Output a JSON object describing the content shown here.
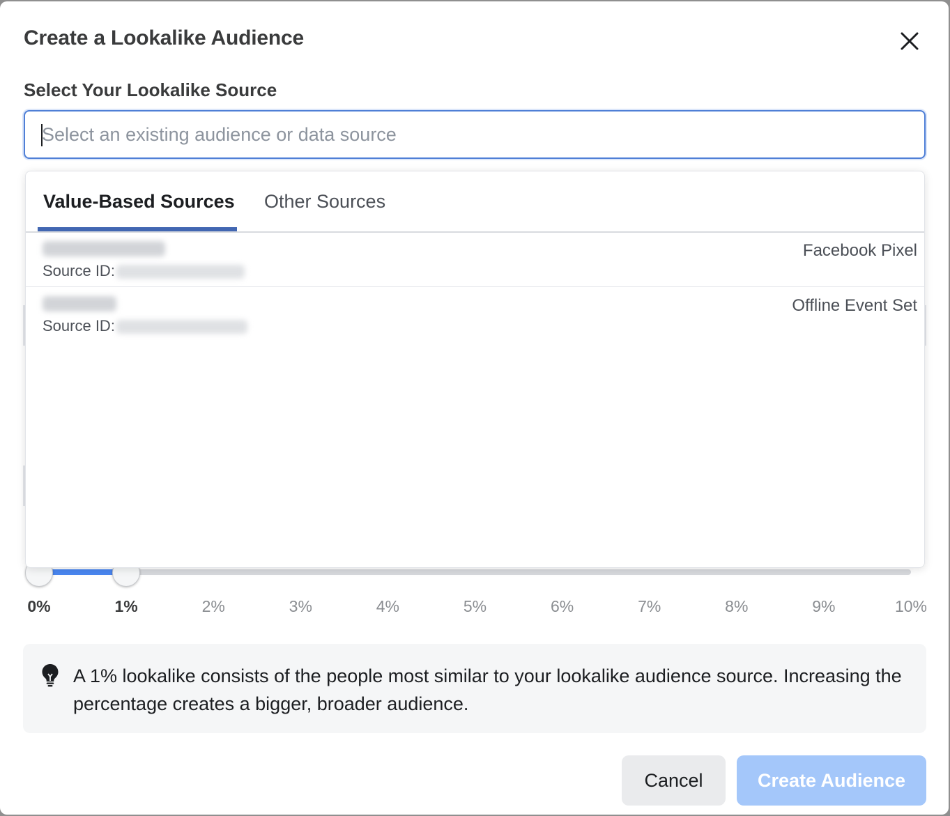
{
  "dialog": {
    "title": "Create a Lookalike Audience",
    "close_icon": "close-x-icon"
  },
  "source": {
    "label": "Select Your Lookalike Source",
    "placeholder": "Select an existing audience or data source",
    "value": ""
  },
  "dropdown": {
    "tabs": [
      {
        "label": "Value-Based Sources",
        "active": true
      },
      {
        "label": "Other Sources",
        "active": false
      }
    ],
    "items": [
      {
        "source_id_label": "Source ID:",
        "type": "Facebook Pixel"
      },
      {
        "source_id_label": "Source ID:",
        "type": "Offline Event Set"
      }
    ]
  },
  "audience_size": {
    "range_start_percent": 0,
    "range_end_percent": 1,
    "max_percent": 10,
    "ticks": [
      "0%",
      "1%",
      "2%",
      "3%",
      "4%",
      "5%",
      "6%",
      "7%",
      "8%",
      "9%",
      "10%"
    ]
  },
  "info": {
    "icon": "lightbulb-icon",
    "text": "A 1% lookalike consists of the people most similar to your lookalike audience source. Increasing the percentage creates a bigger, broader audience."
  },
  "footer": {
    "cancel_label": "Cancel",
    "create_label": "Create Audience"
  },
  "colors": {
    "accent": "#4267b2",
    "slider_fill": "#4a86f0",
    "create_disabled": "#a4c7fa"
  }
}
